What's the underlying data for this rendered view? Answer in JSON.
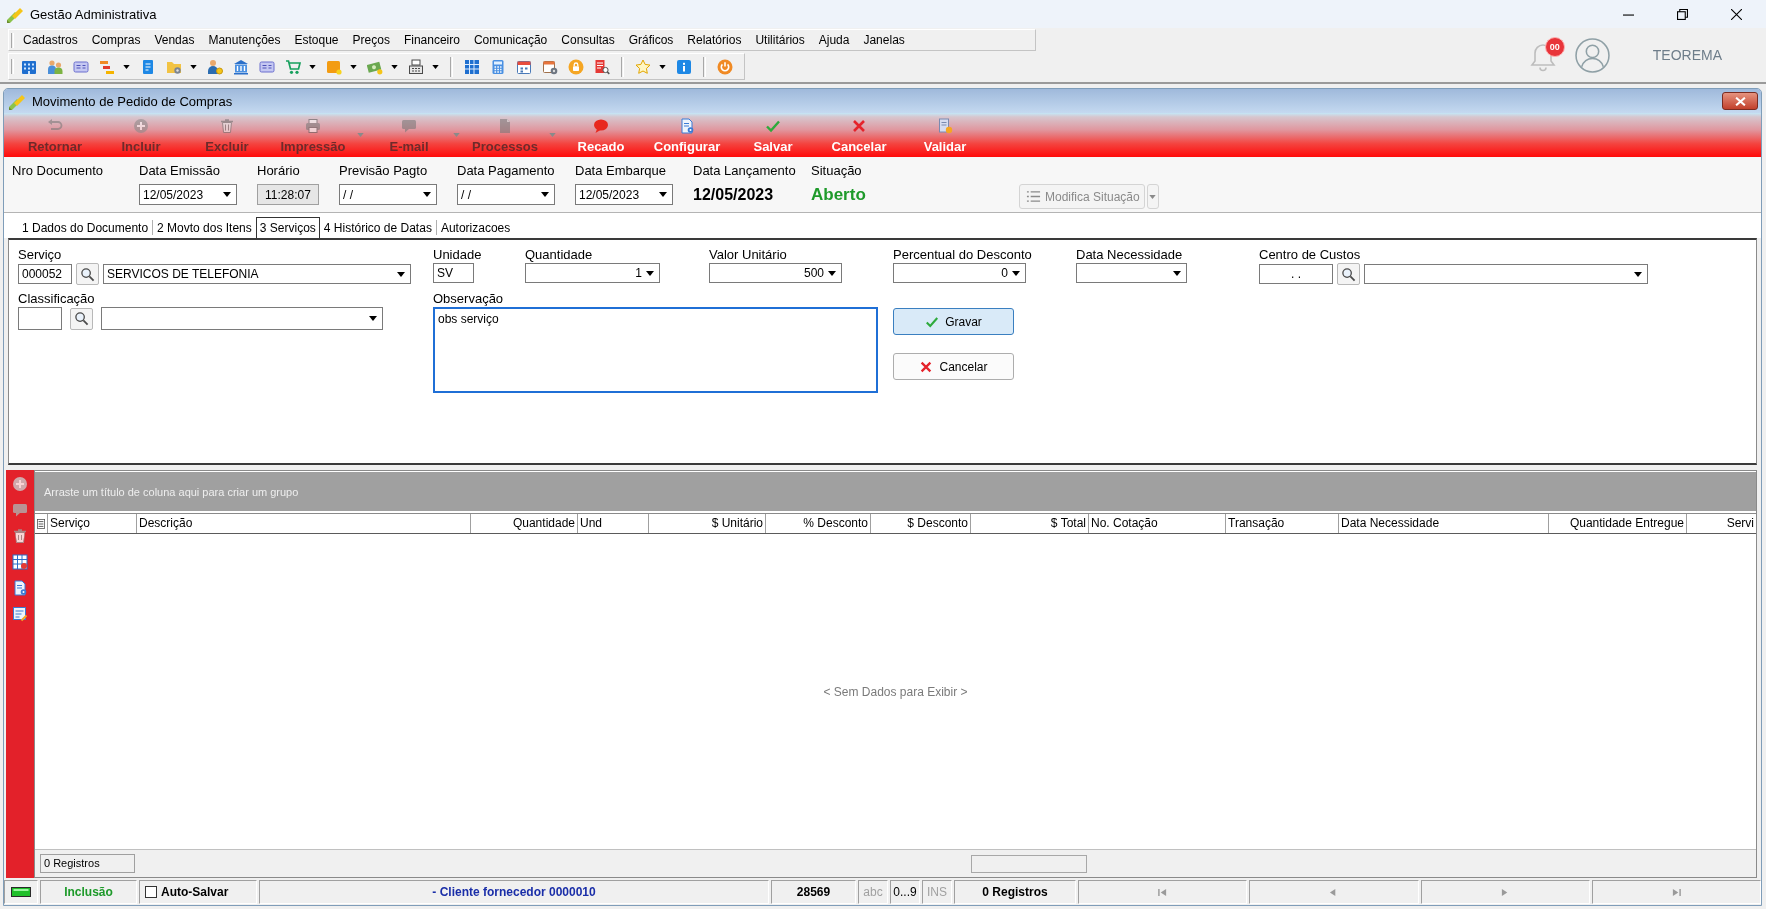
{
  "app_window": {
    "title": "Gestão Administrativa"
  },
  "menu_bar": [
    "Cadastros",
    "Compras",
    "Vendas",
    "Manutenções",
    "Estoque",
    "Preços",
    "Financeiro",
    "Comunicação",
    "Consultas",
    "Gráficos",
    "Relatórios",
    "Utilitários",
    "Ajuda",
    "Janelas"
  ],
  "user_area": {
    "notification_badge": "00",
    "user_name": "TEOREMA"
  },
  "child_window": {
    "title": "Movimento de Pedido de Compras"
  },
  "toolbar": [
    {
      "label": "Retornar",
      "disabled": true,
      "has_menu": false
    },
    {
      "label": "Incluir",
      "disabled": true,
      "has_menu": false
    },
    {
      "label": "Excluir",
      "disabled": true,
      "has_menu": false
    },
    {
      "label": "Impressão",
      "disabled": true,
      "has_menu": true
    },
    {
      "label": "E-mail",
      "disabled": true,
      "has_menu": true
    },
    {
      "label": "Processos",
      "disabled": true,
      "has_menu": true
    },
    {
      "label": "Recado",
      "disabled": false,
      "has_menu": false
    },
    {
      "label": "Configurar",
      "disabled": false,
      "has_menu": false
    },
    {
      "label": "Salvar",
      "disabled": false,
      "has_menu": false
    },
    {
      "label": "Cancelar",
      "disabled": false,
      "has_menu": false
    },
    {
      "label": "Validar",
      "disabled": false,
      "has_menu": false
    }
  ],
  "header": {
    "fields": [
      {
        "kind": "label",
        "label": "Nro Documento"
      },
      {
        "kind": "combo",
        "label": "Data Emissão",
        "value": "12/05/2023"
      },
      {
        "kind": "readonly",
        "label": "Horário",
        "value": "11:28:07"
      },
      {
        "kind": "combo",
        "label": "Previsão Pagto",
        "value": "/ /"
      },
      {
        "kind": "combo",
        "label": "Data Pagamento",
        "value": "/ /"
      },
      {
        "kind": "combo",
        "label": "Data Embarque",
        "value": "12/05/2023"
      },
      {
        "kind": "display",
        "label": "Data Lançamento",
        "value": "12/05/2023"
      },
      {
        "kind": "status",
        "label": "Situação",
        "value": "Aberto"
      }
    ],
    "status_button": {
      "label": "Modifica Situação",
      "disabled": true
    }
  },
  "tabs": [
    {
      "label": "1 Dados do Documento",
      "selected": false
    },
    {
      "label": "2 Movto dos Itens",
      "selected": false
    },
    {
      "label": "3 Serviços",
      "selected": true
    },
    {
      "label": "4 Histórico de Datas",
      "selected": false
    },
    {
      "label": "Autorizacoes",
      "selected": false
    }
  ],
  "service_form": {
    "servico": {
      "label": "Serviço",
      "code": "000052",
      "description": "SERVICOS DE TELEFONIA"
    },
    "unidade": {
      "label": "Unidade",
      "value": "SV"
    },
    "quantidade": {
      "label": "Quantidade",
      "value": "1"
    },
    "valor_unitario": {
      "label": "Valor Unitário",
      "value": "500"
    },
    "percentual_desconto": {
      "label": "Percentual do Desconto",
      "value": "0"
    },
    "data_necessidade": {
      "label": "Data Necessidade"
    },
    "centro_de_custos": {
      "label": "Centro de Custos",
      "code": ". ."
    },
    "classificacao": {
      "label": "Classificação"
    },
    "observacao": {
      "label": "Observação",
      "value": "obs serviço",
      "focused": true
    },
    "buttons": [
      {
        "label": "Gravar",
        "default": true
      },
      {
        "label": "Cancelar",
        "default": false
      }
    ]
  },
  "grid": {
    "group_hint": "Arraste um título de coluna aqui para criar um grupo",
    "columns": [
      {
        "label": "Serviço",
        "right_aligned": false
      },
      {
        "label": "Descrição",
        "right_aligned": false
      },
      {
        "label": "Quantidade",
        "right_aligned": true
      },
      {
        "label": "Und",
        "right_aligned": false
      },
      {
        "label": "$ Unitário",
        "right_aligned": true
      },
      {
        "label": "% Desconto",
        "right_aligned": true
      },
      {
        "label": "$ Desconto",
        "right_aligned": true
      },
      {
        "label": "$ Total",
        "right_aligned": true
      },
      {
        "label": "No. Cotação",
        "right_aligned": false
      },
      {
        "label": "Transação",
        "right_aligned": false
      },
      {
        "label": "Data Necessidade",
        "right_aligned": false
      },
      {
        "label": "Quantidade Entregue",
        "right_aligned": true
      },
      {
        "label": "Servi",
        "right_aligned": true
      }
    ],
    "empty_text": "< Sem Dados para Exibir >",
    "footer_count": "0 Registros"
  },
  "status_bar": {
    "mode": "Inclusão",
    "auto_save": {
      "label": "Auto-Salvar",
      "checked": false
    },
    "client": "- Cliente fornecedor 0000010",
    "code": "28569",
    "indicators": [
      {
        "label": "abc",
        "active": false
      },
      {
        "label": "0...9",
        "active": true
      },
      {
        "label": "INS",
        "active": false
      }
    ],
    "records": "0 Registros"
  }
}
